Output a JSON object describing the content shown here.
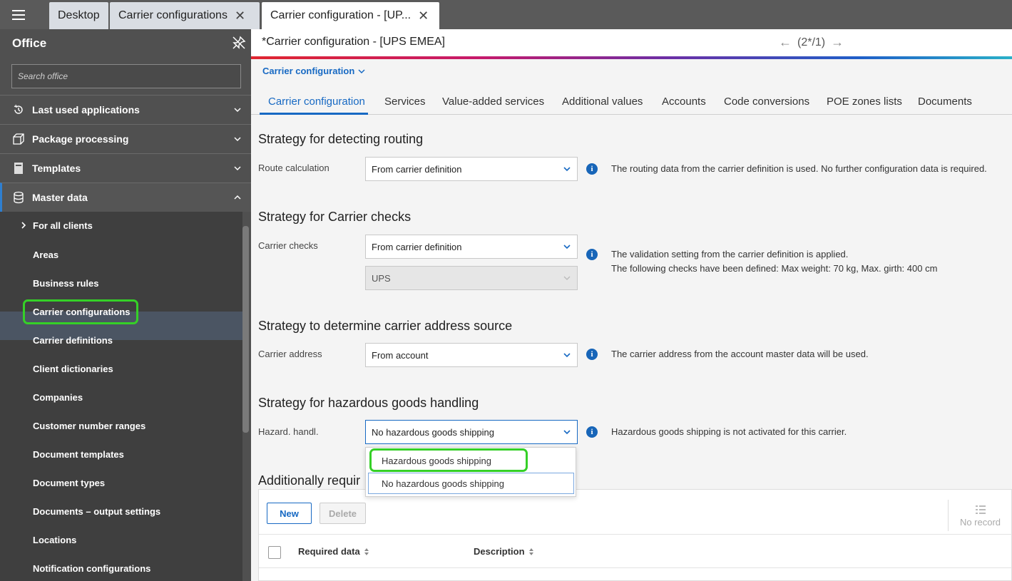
{
  "tabs": [
    {
      "label": "Desktop"
    },
    {
      "label": "Carrier configurations"
    },
    {
      "label": "Carrier configuration - [UP..."
    }
  ],
  "sidebar": {
    "title": "Office",
    "search_placeholder": "Search office",
    "groups": [
      {
        "label": "Last used applications",
        "icon": "history-icon"
      },
      {
        "label": "Package processing",
        "icon": "package-icon"
      },
      {
        "label": "Templates",
        "icon": "template-icon"
      },
      {
        "label": "Master data",
        "icon": "database-icon"
      }
    ],
    "items": [
      "For all clients",
      "Areas",
      "Business rules",
      "Carrier configurations",
      "Carrier definitions",
      "Client dictionaries",
      "Companies",
      "Customer number ranges",
      "Document templates",
      "Document types",
      "Documents – output settings",
      "Locations",
      "Notification configurations"
    ],
    "selected": "Carrier configurations"
  },
  "main": {
    "page_title": "*Carrier configuration - [UPS EMEA]",
    "nav_position": "(2*/1)",
    "breadcrumb": "Carrier configuration",
    "content_tabs": [
      "Carrier configuration",
      "Services",
      "Value-added services",
      "Additional values",
      "Accounts",
      "Code conversions",
      "POE zones lists",
      "Documents"
    ],
    "active_tab": "Carrier configuration",
    "sections": {
      "routing": {
        "title": "Strategy for detecting routing",
        "label": "Route calculation",
        "value": "From carrier definition",
        "info": "The routing data from the carrier definition is used. No further configuration data is required."
      },
      "checks": {
        "title": "Strategy for Carrier checks",
        "label": "Carrier checks",
        "value": "From carrier definition",
        "sub_value": "UPS",
        "info_line1": "The validation setting from the carrier definition is applied.",
        "info_line2": "The following checks have been defined: Max weight: 70 kg, Max. girth: 400 cm"
      },
      "address": {
        "title": "Strategy to determine carrier address source",
        "label": "Carrier address",
        "value": "From account",
        "info": "The carrier address from the account master data will be used."
      },
      "hazard": {
        "title": "Strategy for hazardous goods handling",
        "label": "Hazard. handl.",
        "value": "No hazardous goods shipping",
        "info": "Hazardous goods shipping is not activated for this carrier.",
        "options": [
          "Hazardous goods shipping",
          "No hazardous goods shipping"
        ]
      },
      "additional": {
        "title": "Additionally requir"
      }
    },
    "table": {
      "new_label": "New",
      "delete_label": "Delete",
      "no_record": "No record",
      "columns": [
        "Required data",
        "Description"
      ]
    }
  },
  "colors": {
    "accent": "#1769c3",
    "highlight": "#35d027",
    "sidebar_bg": "#505050"
  }
}
